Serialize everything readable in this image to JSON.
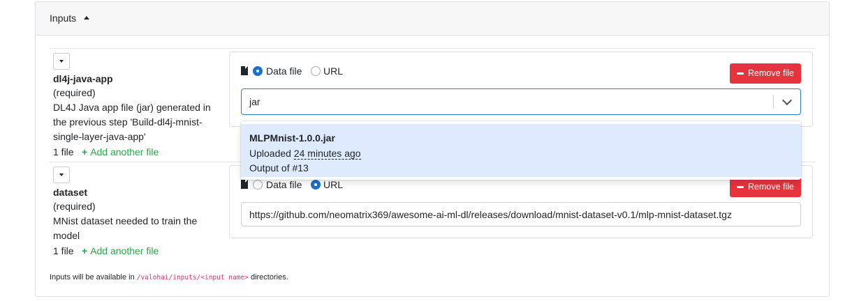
{
  "header": {
    "title": "Inputs"
  },
  "inputs": [
    {
      "name": "dl4j-java-app",
      "required": "(required)",
      "description_lines": [
        "DL4J Java app file (jar) generated in",
        "the previous step 'Build-dl4j-mnist-",
        "single-layer-java-app'"
      ],
      "file_count": "1 file",
      "add_file": "Add another file",
      "source_options": {
        "data_file": "Data file",
        "url": "URL",
        "selected": "data_file"
      },
      "remove_label": "Remove file",
      "select_value": "jar",
      "dropdown_option": {
        "title": "MLPMnist-1.0.0.jar",
        "uploaded_prefix": "Uploaded ",
        "uploaded_ago": "24 minutes ago",
        "output": "Output of #13"
      }
    },
    {
      "name": "dataset",
      "required": "(required)",
      "description_lines": [
        "MNist dataset needed to train the",
        "model"
      ],
      "file_count": "1 file",
      "add_file": "Add another file",
      "source_options": {
        "data_file": "Data file",
        "url": "URL",
        "selected": "url"
      },
      "remove_label": "Remove file",
      "url_value": "https://github.com/neomatrix369/awesome-ai-ml-dl/releases/download/mnist-dataset-v0.1/mlp-mnist-dataset.tgz"
    }
  ],
  "footer": {
    "prefix": "Inputs will be available in ",
    "path": "/valohai/inputs/<input name>",
    "suffix": " directories."
  },
  "colors": {
    "accent": "#1a73c9",
    "danger": "#e5343d",
    "success": "#28a745",
    "dropdown_highlight": "#deebff"
  }
}
